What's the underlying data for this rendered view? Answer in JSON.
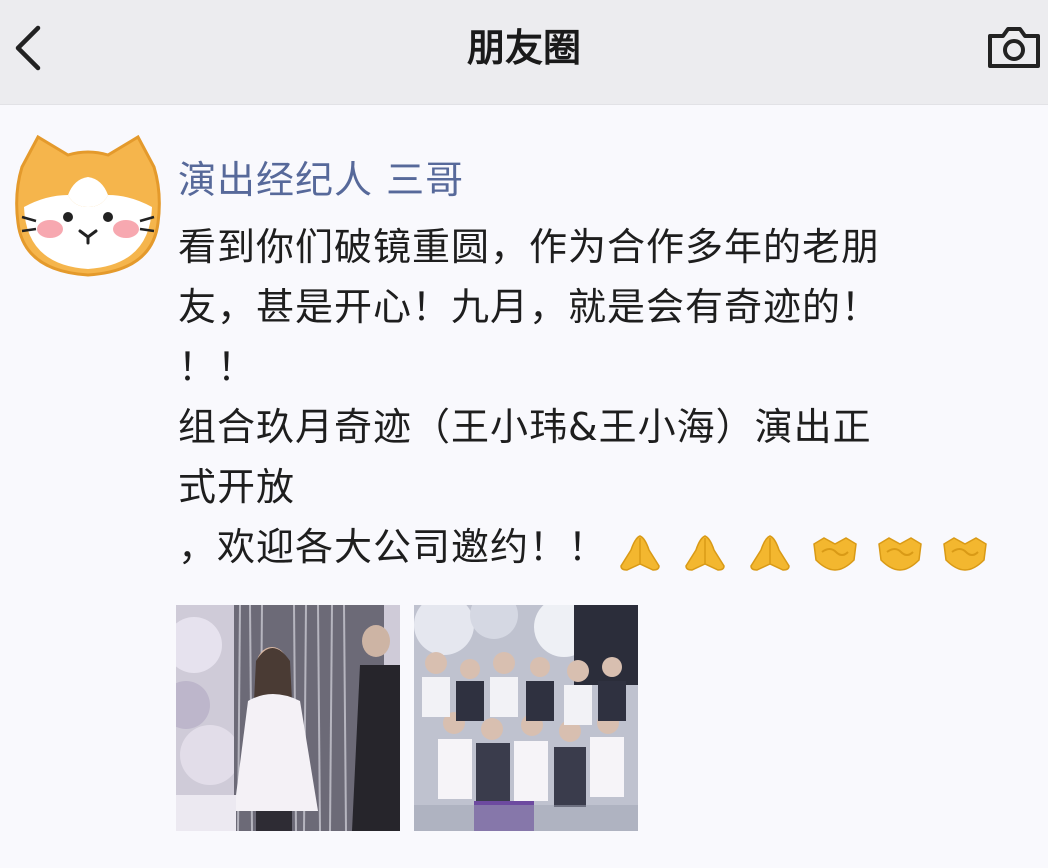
{
  "header": {
    "title": "朋友圈",
    "back_icon": "chevron-left-icon",
    "camera_icon": "camera-icon"
  },
  "post": {
    "author": "演出经纪人  三哥",
    "lines": [
      "看到你们破镜重圆，作为合作多年的老朋",
      "友，甚是开心！九月，就是会有奇迹的！",
      "！！",
      "组合玖月奇迹（王小玮&王小海）演出正",
      "式开放",
      "，欢迎各大公司邀约！！"
    ],
    "emojis": [
      "praying-hands-icon",
      "praying-hands-icon",
      "praying-hands-icon",
      "handshake-icon",
      "handshake-icon",
      "handshake-icon"
    ],
    "photos": [
      "photo-1",
      "photo-2"
    ]
  },
  "colors": {
    "author_name": "#57699a",
    "header_bg": "#ececef",
    "body_bg": "#f9f9fd",
    "emoji": "#f3b72f"
  }
}
